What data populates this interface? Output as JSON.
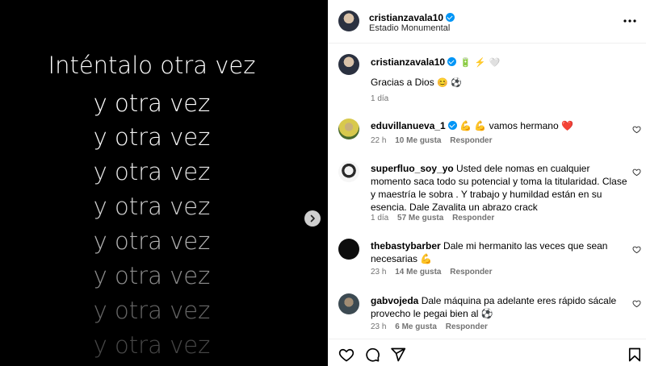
{
  "media": {
    "lines": [
      "Inténtalo otra vez",
      "y otra vez",
      "y otra vez",
      "y otra vez",
      "y otra vez",
      "y otra vez",
      "y otra vez",
      "y otra vez",
      "y otra vez"
    ]
  },
  "header": {
    "username": "cristianzavala10",
    "location": "Estadio Monumental"
  },
  "caption": {
    "username": "cristianzavala10",
    "text": "Gracias a Dios",
    "time": "1 día"
  },
  "comments": [
    {
      "username": "eduvillanueva_1",
      "text": "💪 💪 vamos hermano ❤️",
      "time": "22 h",
      "likes": "10 Me gusta",
      "reply": "Responder"
    },
    {
      "username": "superfluo_soy_yo",
      "text": "Usted dele nomas en cualquier momento saca todo su potencial y toma la titularidad. Clase y maestría le sobra . Y trabajo y humildad están en su esencia. Dale Zavalita un abrazo crack",
      "time": "1 día",
      "likes": "57 Me gusta",
      "reply": "Responder"
    },
    {
      "username": "thebastybarber",
      "text": "Dale mi hermanito las veces que sean necesarias 💪",
      "time": "23 h",
      "likes": "14 Me gusta",
      "reply": "Responder"
    },
    {
      "username": "gabvojeda",
      "text": "Dale máquina pa adelante eres rápido sácale provecho le pegai bien al ⚽",
      "time": "23 h",
      "likes": "6 Me gusta",
      "reply": "Responder"
    }
  ],
  "icons": {
    "verified": "verified-badge-icon",
    "more": "more-options-icon",
    "like": "heart-icon",
    "comment": "comment-icon",
    "share": "share-icon",
    "save": "bookmark-icon",
    "next": "chevron-right-icon"
  },
  "colors": {
    "verified": "#0095f6",
    "meta": "#737373",
    "heart": "#ed4956"
  }
}
